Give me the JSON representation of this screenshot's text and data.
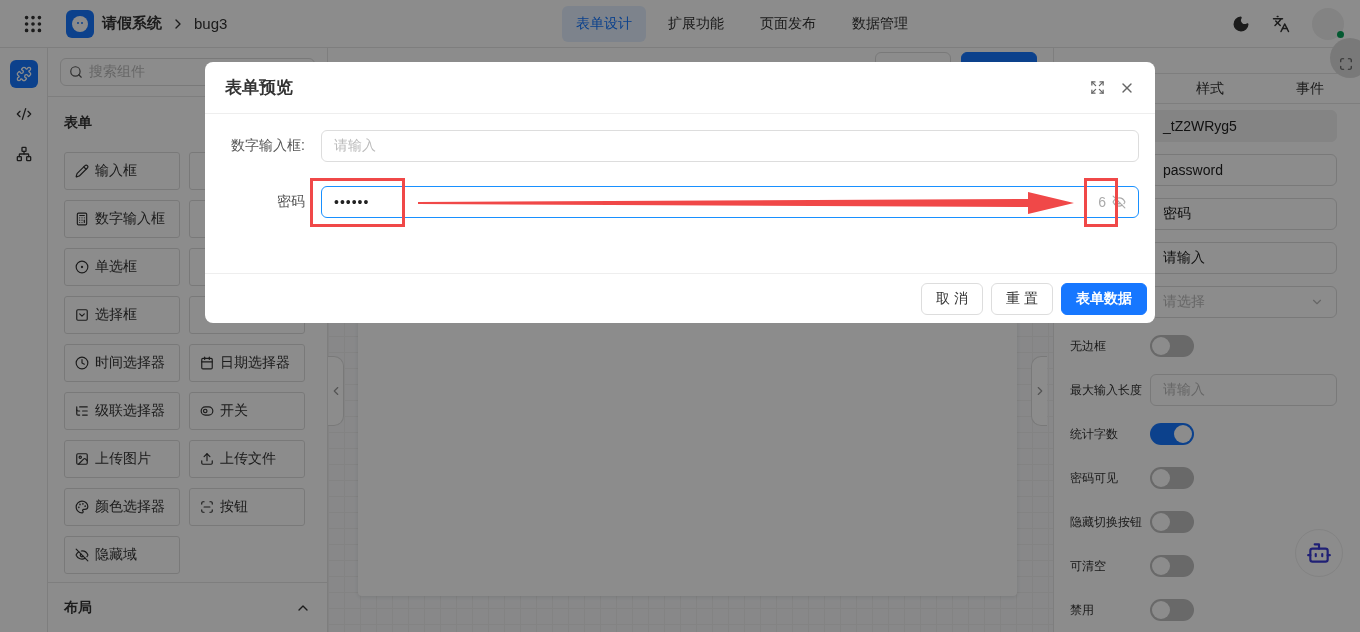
{
  "header": {
    "app_name": "请假系统",
    "page": "bug3",
    "tabs": [
      {
        "label": "表单设计",
        "selected": true
      },
      {
        "label": "扩展功能",
        "selected": false
      },
      {
        "label": "页面发布",
        "selected": false
      },
      {
        "label": "数据管理",
        "selected": false
      }
    ]
  },
  "rail": [
    {
      "selected": true
    },
    {
      "selected": false
    },
    {
      "selected": false
    }
  ],
  "component_panel": {
    "search_placeholder": "搜索组件",
    "section_title": "表单",
    "components": [
      {
        "label": "输入框"
      },
      {
        "label": "数字输入框"
      },
      {
        "label": "单选框"
      },
      {
        "label": "选择框"
      },
      {
        "label": "时间选择器"
      },
      {
        "label": "日期选择器"
      },
      {
        "label": "级联选择器"
      },
      {
        "label": "开关"
      },
      {
        "label": "上传图片"
      },
      {
        "label": "上传文件"
      },
      {
        "label": "颜色选择器"
      },
      {
        "label": "按钮"
      },
      {
        "label": "隐藏域"
      }
    ],
    "layout_title": "布局"
  },
  "properties_panel": {
    "tabs": [
      {
        "label": "样式",
        "selected": false
      },
      {
        "label": "事件",
        "selected": false
      }
    ],
    "rows": [
      {
        "kind": "readonly",
        "value": "_tZ2WRyg5"
      },
      {
        "kind": "input",
        "value": "password"
      },
      {
        "kind": "input",
        "value": "密码"
      },
      {
        "kind": "input",
        "value": "请输入"
      },
      {
        "kind": "select",
        "placeholder": "请选择"
      },
      {
        "kind": "switch",
        "label": "无边框",
        "on": false
      },
      {
        "kind": "input",
        "label": "最大输入长度",
        "placeholder": "请输入"
      },
      {
        "kind": "switch",
        "label": "统计字数",
        "on": true
      },
      {
        "kind": "switch",
        "label": "密码可见",
        "on": false
      },
      {
        "kind": "switch",
        "label": "隐藏切换按钮",
        "on": false
      },
      {
        "kind": "switch",
        "label": "可清空",
        "on": false
      },
      {
        "kind": "switch",
        "label": "禁用",
        "on": false
      }
    ]
  },
  "modal": {
    "title": "表单预览",
    "fields": [
      {
        "label": "数字输入框:",
        "placeholder": "请输入",
        "focused": false
      },
      {
        "label": "密码",
        "value": "••••••",
        "count": "6",
        "focused": true
      }
    ],
    "buttons": [
      {
        "label": "取 消",
        "primary": false
      },
      {
        "label": "重 置",
        "primary": false
      },
      {
        "label": "表单数据",
        "primary": true
      }
    ]
  }
}
